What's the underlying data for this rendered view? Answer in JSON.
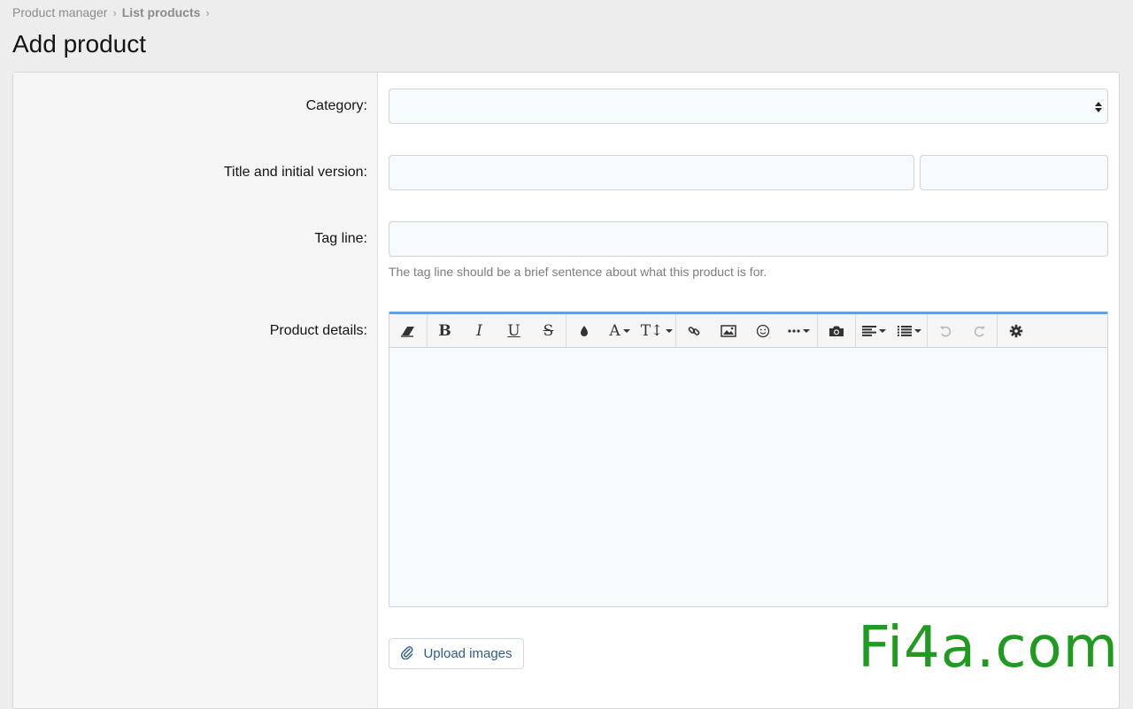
{
  "breadcrumb": {
    "items": [
      "Product manager",
      "List products"
    ],
    "separator": "›"
  },
  "page": {
    "title": "Add product"
  },
  "form": {
    "category": {
      "label": "Category:",
      "value": ""
    },
    "title": {
      "label": "Title and initial version:",
      "title_value": "",
      "version_value": ""
    },
    "tagline": {
      "label": "Tag line:",
      "value": "",
      "hint": "The tag line should be a brief sentence about what this product is for."
    },
    "details": {
      "label": "Product details:",
      "toolbar": {
        "bold": "B",
        "italic": "I",
        "underline": "U",
        "strike": "S",
        "font_color": "A",
        "font_size": "T↕"
      }
    },
    "upload": {
      "label": "Upload images"
    }
  },
  "watermark": "Fi4a.com",
  "colors": {
    "accent": "#5fa2dd",
    "link": "#2f5d8a",
    "watermark": "#1f9c1f",
    "label_panel": "#f5f5f5"
  }
}
